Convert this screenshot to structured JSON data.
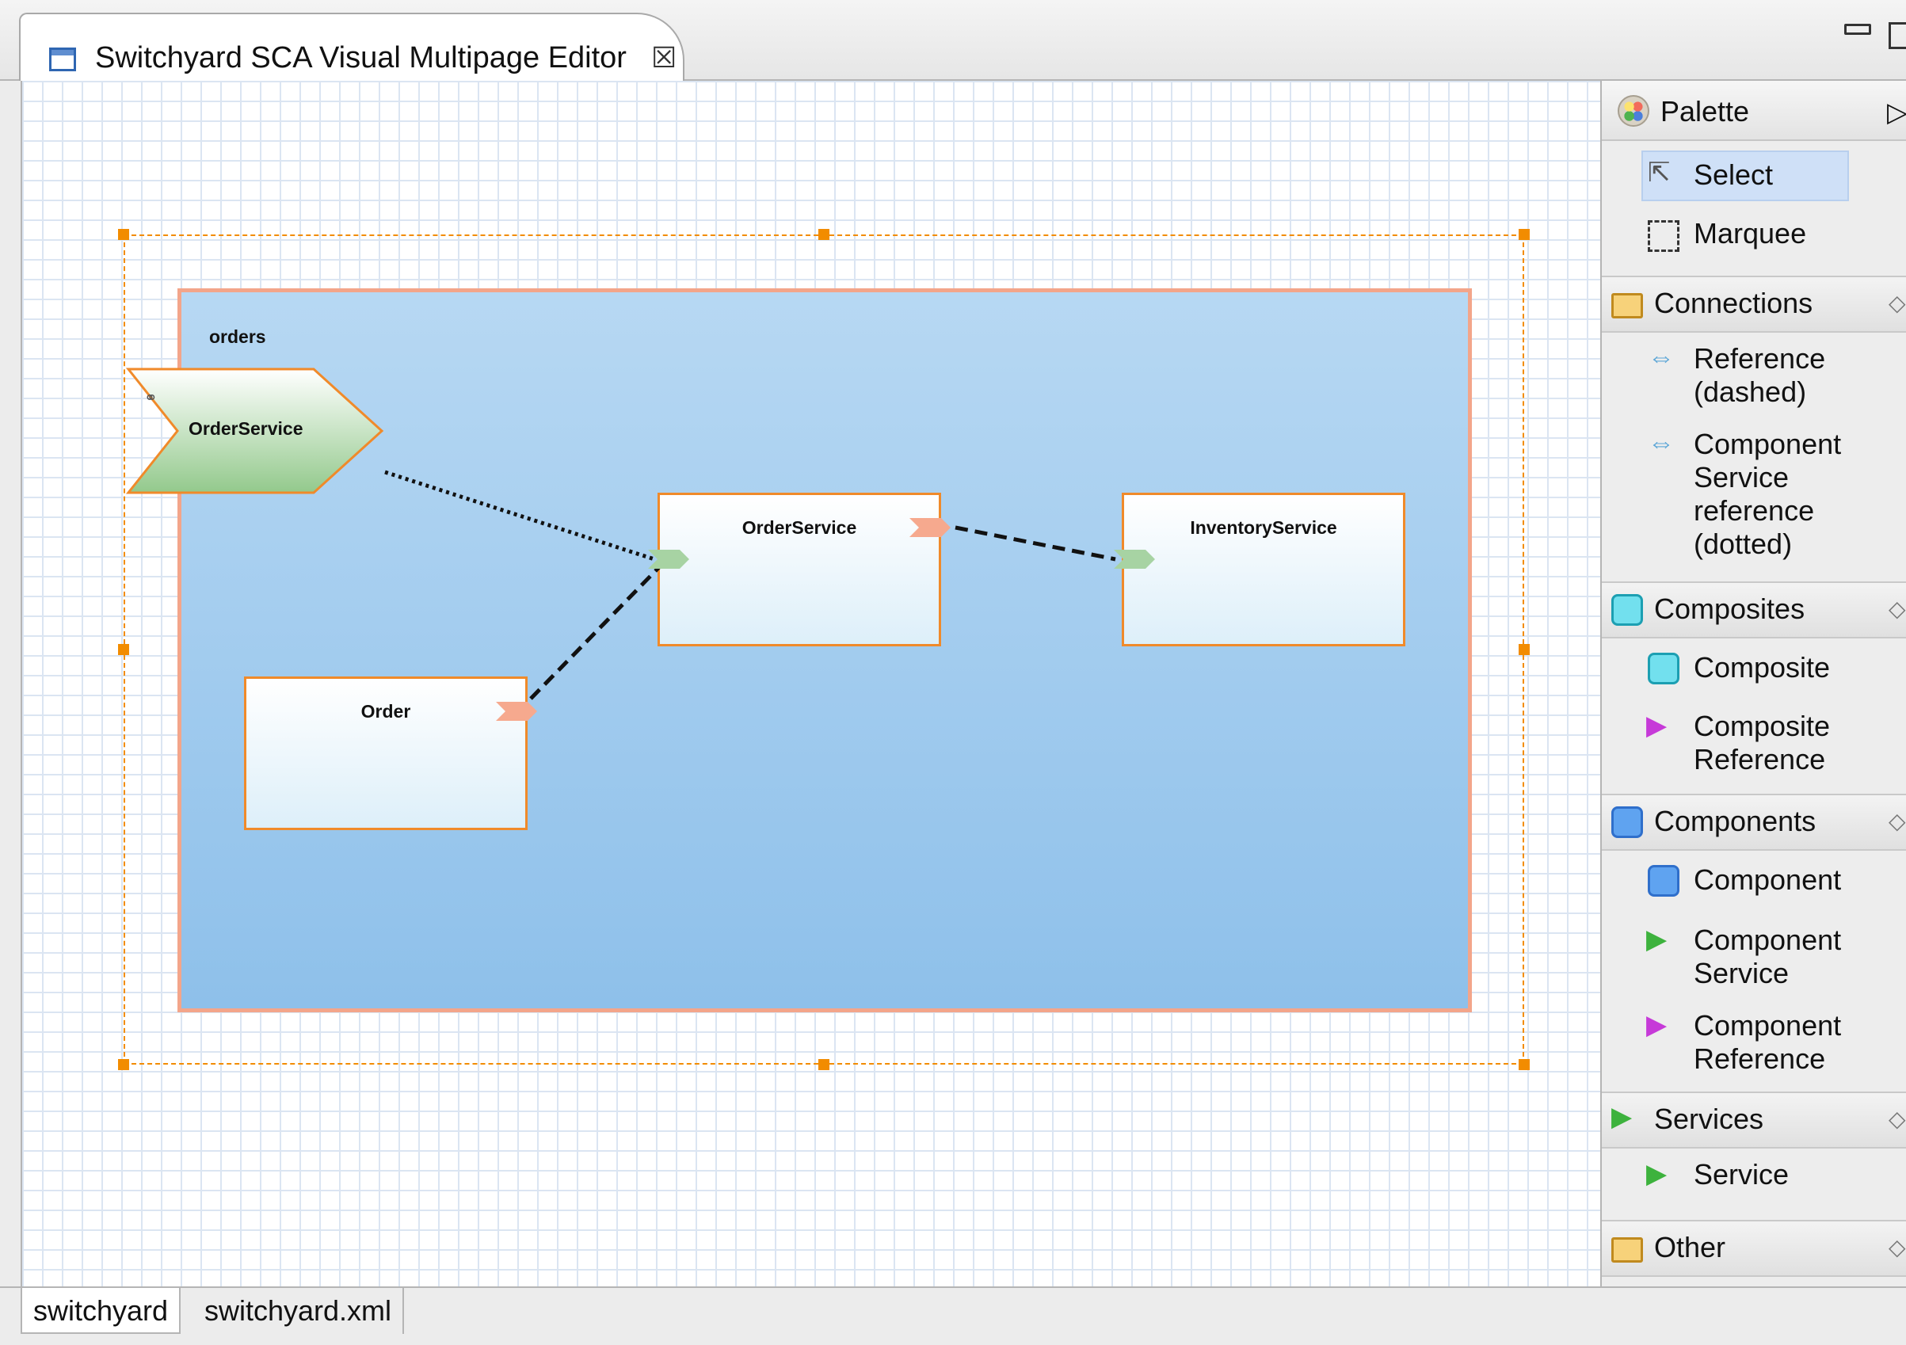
{
  "editor": {
    "tab_title": "Switchyard SCA Visual Multipage Editor",
    "close_glyph": "☒"
  },
  "diagram": {
    "composite_name": "orders",
    "composite_service_name": "OrderService",
    "components": {
      "order_service": "OrderService",
      "inventory_service": "InventoryService",
      "order": "Order"
    },
    "colors": {
      "selection": "#f28c00",
      "composite_border": "#f3a58a",
      "component_border": "#f08a2a",
      "service_fill": "#a7d3a3",
      "reference_fill": "#f6a98e"
    }
  },
  "palette": {
    "title": "Palette",
    "tools": {
      "select": "Select",
      "marquee": "Marquee"
    },
    "drawers": {
      "connections": {
        "label": "Connections",
        "items": [
          "Reference\n(dashed)",
          "Component\nService\nreference\n(dotted)"
        ]
      },
      "composites": {
        "label": "Composites",
        "items": [
          "Composite",
          "Composite\nReference"
        ]
      },
      "components": {
        "label": "Components",
        "items": [
          "Component",
          "Component\nService",
          "Component\nReference"
        ]
      },
      "services": {
        "label": "Services",
        "items": [
          "Service"
        ]
      },
      "other": {
        "label": "Other"
      }
    },
    "icons": {
      "connection": "double-arrow-icon",
      "composite": "cyan-square-icon",
      "component": "blue-square-icon",
      "reference": "magenta-chevron-icon",
      "service": "green-chevron-icon"
    }
  },
  "bottom_tabs": [
    "switchyard",
    "switchyard.xml"
  ]
}
